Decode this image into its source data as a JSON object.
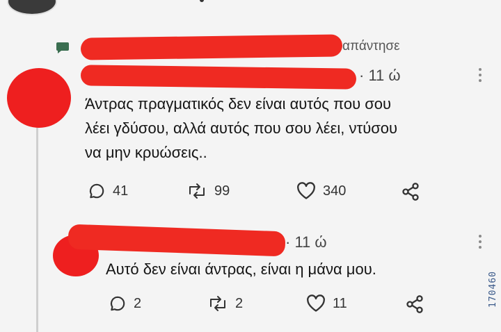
{
  "reply_context": {
    "suffix": "απάντησε"
  },
  "comment": {
    "time": "· 11 ώ",
    "lines": [
      "Άντρας πραγματικός δεν είναι αυτός που σου",
      "λέει γδύσου, αλλά αυτός που σου λέει, ντύσου",
      "να μην κρυώσεις.."
    ],
    "replies": "41",
    "reposts": "99",
    "likes": "340"
  },
  "reply": {
    "time": "· 11 ώ",
    "text": "Αυτό δεν είναι άντρας, είναι η μάνα μου.",
    "replies": "2",
    "reposts": "2",
    "likes": "11"
  },
  "watermark": "170460",
  "icons": [
    "chat-bubble-icon",
    "comment-icon",
    "repost-icon",
    "heart-icon",
    "share-icon",
    "more-vert-icon"
  ],
  "colors": {
    "redaction": "#ef2a22",
    "background": "#f4f4f4"
  }
}
